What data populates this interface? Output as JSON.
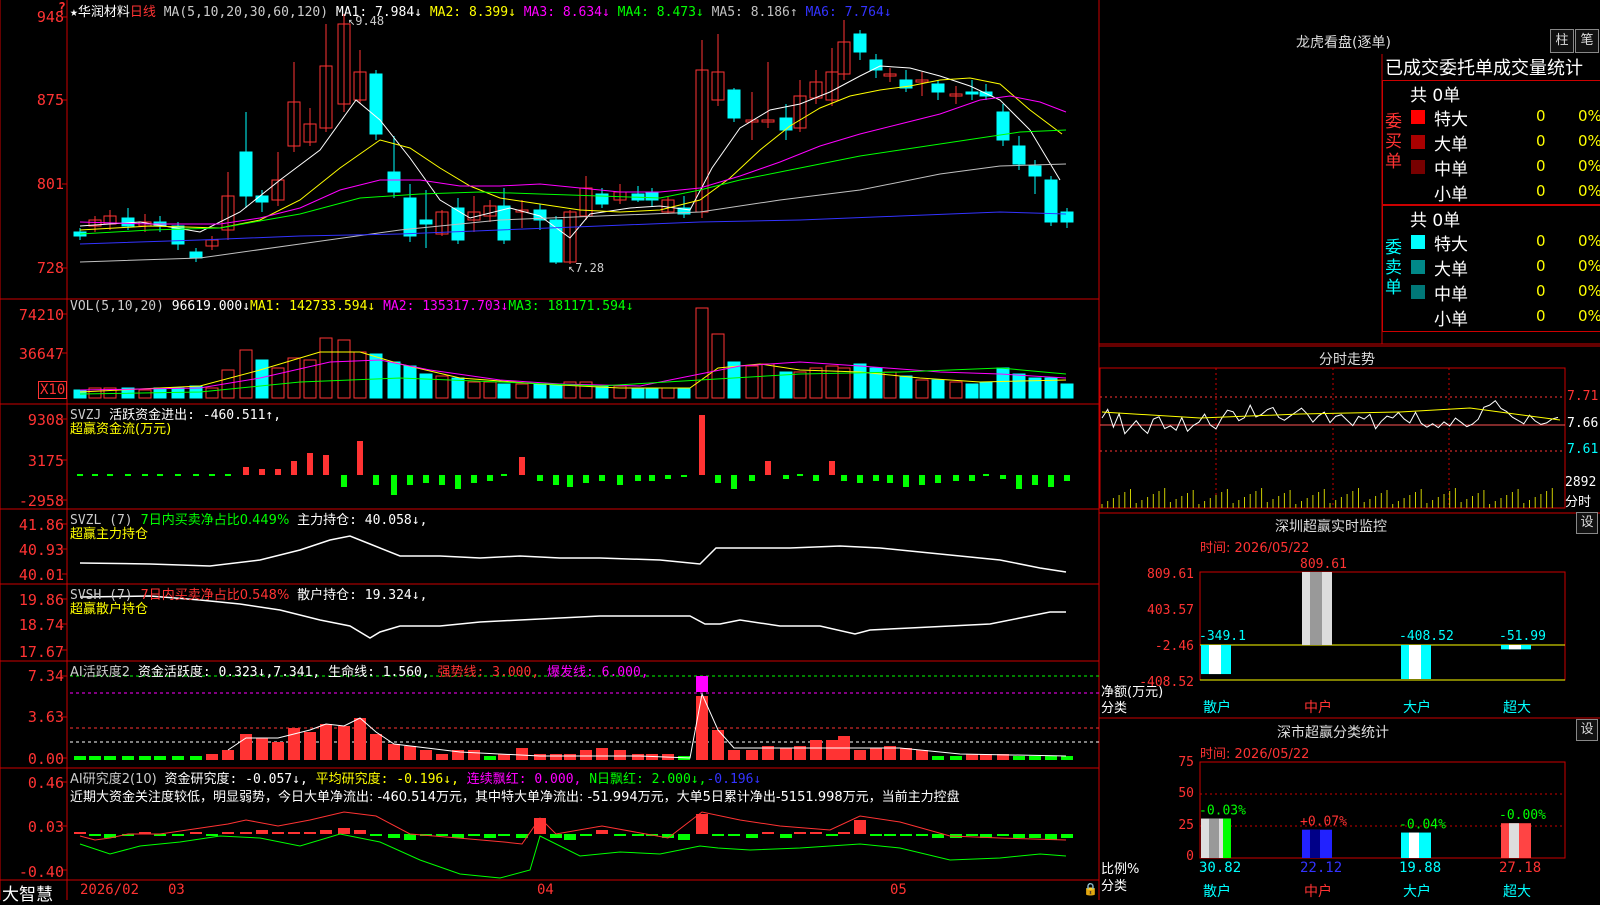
{
  "colors": {
    "up": "#ff3333",
    "down": "#00ffff",
    "ma1": "#ffffff",
    "ma2": "#ffff00",
    "ma3": "#ff00ff",
    "ma4": "#00ff00",
    "ma5": "#c0c0c0",
    "ma6": "#3333ff"
  },
  "main": {
    "star": "★",
    "stock_name": "华润材料",
    "period": "日线",
    "ma_params": "MA(5,10,20,30,60,120)",
    "ma_values": [
      {
        "label": "MA1: 7.984↓",
        "color": "#ffffff"
      },
      {
        "label": "MA2: 8.399↓",
        "color": "#ffff00"
      },
      {
        "label": "MA3: 8.634↓",
        "color": "#ff00ff"
      },
      {
        "label": "MA4: 8.473↓",
        "color": "#00ff00"
      },
      {
        "label": "MA5: 8.186↑",
        "color": "#c0c0c0"
      },
      {
        "label": "MA6: 7.764↓",
        "color": "#3333ff"
      }
    ],
    "y_ticks": [
      "948",
      "875",
      "801",
      "728"
    ],
    "high_label": "9.48",
    "low_label": "7.28",
    "question": "?"
  },
  "vol": {
    "title": "VOL(5,10,20)",
    "value": "96619.000↓",
    "ma1": "MA1: 142733.594↓",
    "ma2": "MA2: 135317.703↓",
    "ma3": "MA3: 181171.594↓",
    "y_ticks": [
      "74210",
      "36647"
    ],
    "unit": "X10"
  },
  "svzj": {
    "title": "SVZJ",
    "desc": "活跃资金进出: -460.511↑,",
    "sub": "超赢资金流(万元)",
    "y_ticks": [
      "9308",
      "3175",
      "-2958"
    ]
  },
  "svzl": {
    "title": "SVZL (7)",
    "desc1": "7日内买卖净占比0.449%",
    "desc2": "主力持仓: 40.058↓,",
    "sub": "超赢主力持仓",
    "y_ticks": [
      "41.86",
      "40.93",
      "40.01"
    ]
  },
  "svsh": {
    "title": "SVSH (7)",
    "desc1": "7日内买卖净占比0.548%",
    "desc2": "散户持仓: 19.324↓,",
    "sub": "超赢散户持仓",
    "y_ticks": [
      "19.86",
      "18.74",
      "17.67"
    ]
  },
  "ai_act": {
    "title": "AI活跃度2",
    "desc": "资金活跃度: 0.323↓,",
    "v2": "7.341,",
    "life": "生命线: 1.560,",
    "strong": "强势线: 3.000,",
    "burst": "爆发线: 6.000,",
    "y_ticks": [
      "7.34",
      "3.63",
      "0.00"
    ]
  },
  "ai_res": {
    "title": "AI研究度2(10)",
    "desc": "资金研究度: -0.057↓,",
    "avg": "平均研究度: -0.196↓,",
    "lian": "连续飘红: 0.000,",
    "nday": "N日飘红: 2.000↓,",
    "last": "-0.196↓",
    "commentary": "近期大资金关注度较低，明显弱势，今日大单净流出: -460.514万元，其中特大单净流出: -51.994万元，大单5日累计净出-5151.998万元，当前主力控盘",
    "y_ticks": [
      "0.46",
      "0.03",
      "-0.40"
    ]
  },
  "x_axis": {
    "brand": "大智慧",
    "labels": [
      "2026/02",
      "03",
      "04",
      "05"
    ]
  },
  "right": {
    "lhb_title": "龙虎看盘(逐单)",
    "btn_zhu": "柱",
    "btn_bi": "笔",
    "stats_title": "已成交委托单成交量统计",
    "buy_total": "共 0单",
    "buy_label": "委买单",
    "buy_rows": [
      {
        "name": "特大",
        "color": "#ff0000",
        "count": "0",
        "pct": "0%"
      },
      {
        "name": "大单",
        "color": "#aa0000",
        "count": "0",
        "pct": "0%"
      },
      {
        "name": "中单",
        "color": "#770000",
        "count": "0",
        "pct": "0%"
      },
      {
        "name": "小单",
        "color": "",
        "count": "0",
        "pct": "0%"
      }
    ],
    "sell_total": "共 0单",
    "sell_label": "委卖单",
    "sell_rows": [
      {
        "name": "特大",
        "color": "#00ffff",
        "count": "0",
        "pct": "0%"
      },
      {
        "name": "大单",
        "color": "#008888",
        "count": "0",
        "pct": "0%"
      },
      {
        "name": "中单",
        "color": "#007777",
        "count": "0",
        "pct": "0%"
      },
      {
        "name": "小单",
        "color": "",
        "count": "0",
        "pct": "0%"
      }
    ],
    "fs_title": "分时走势",
    "fs_ticks": [
      "7.71",
      "7.66",
      "7.61"
    ],
    "fs_vol_tick": "2892",
    "fs_vol_label": "分时",
    "sz_title": "深圳超赢实时监控",
    "sz_btn": "设",
    "sz_time": "时间: 2026/05/22",
    "sz_ticks": [
      "809.61",
      "403.57",
      "-2.46",
      "-408.52"
    ],
    "sz_net_label": "净额(万元)",
    "sz_cat_label": "分类",
    "sz_bars": [
      {
        "cat": "散户",
        "value": -349.1,
        "label": "-349.1"
      },
      {
        "cat": "中户",
        "value": 809.61,
        "label": "809.61"
      },
      {
        "cat": "大户",
        "value": -408.52,
        "label": "-408.52"
      },
      {
        "cat": "超大",
        "value": -51.99,
        "label": "-51.99"
      }
    ],
    "ss_title": "深市超赢分类统计",
    "ss_btn": "设",
    "ss_time": "时间: 2026/05/22",
    "ss_ticks": [
      "75",
      "50",
      "25",
      "0"
    ],
    "ss_ratio_label": "比例%",
    "ss_cat_label": "分类",
    "ss_bars": [
      {
        "cat": "散户",
        "value": 30.82,
        "label": "30.82",
        "chg": "-0.03%"
      },
      {
        "cat": "中户",
        "value": 22.12,
        "label": "22.12",
        "chg": "+0.07%"
      },
      {
        "cat": "大户",
        "value": 19.88,
        "label": "19.88",
        "chg": "-0.04%"
      },
      {
        "cat": "超大",
        "value": 27.18,
        "label": "27.18",
        "chg": "-0.00%"
      }
    ]
  }
}
